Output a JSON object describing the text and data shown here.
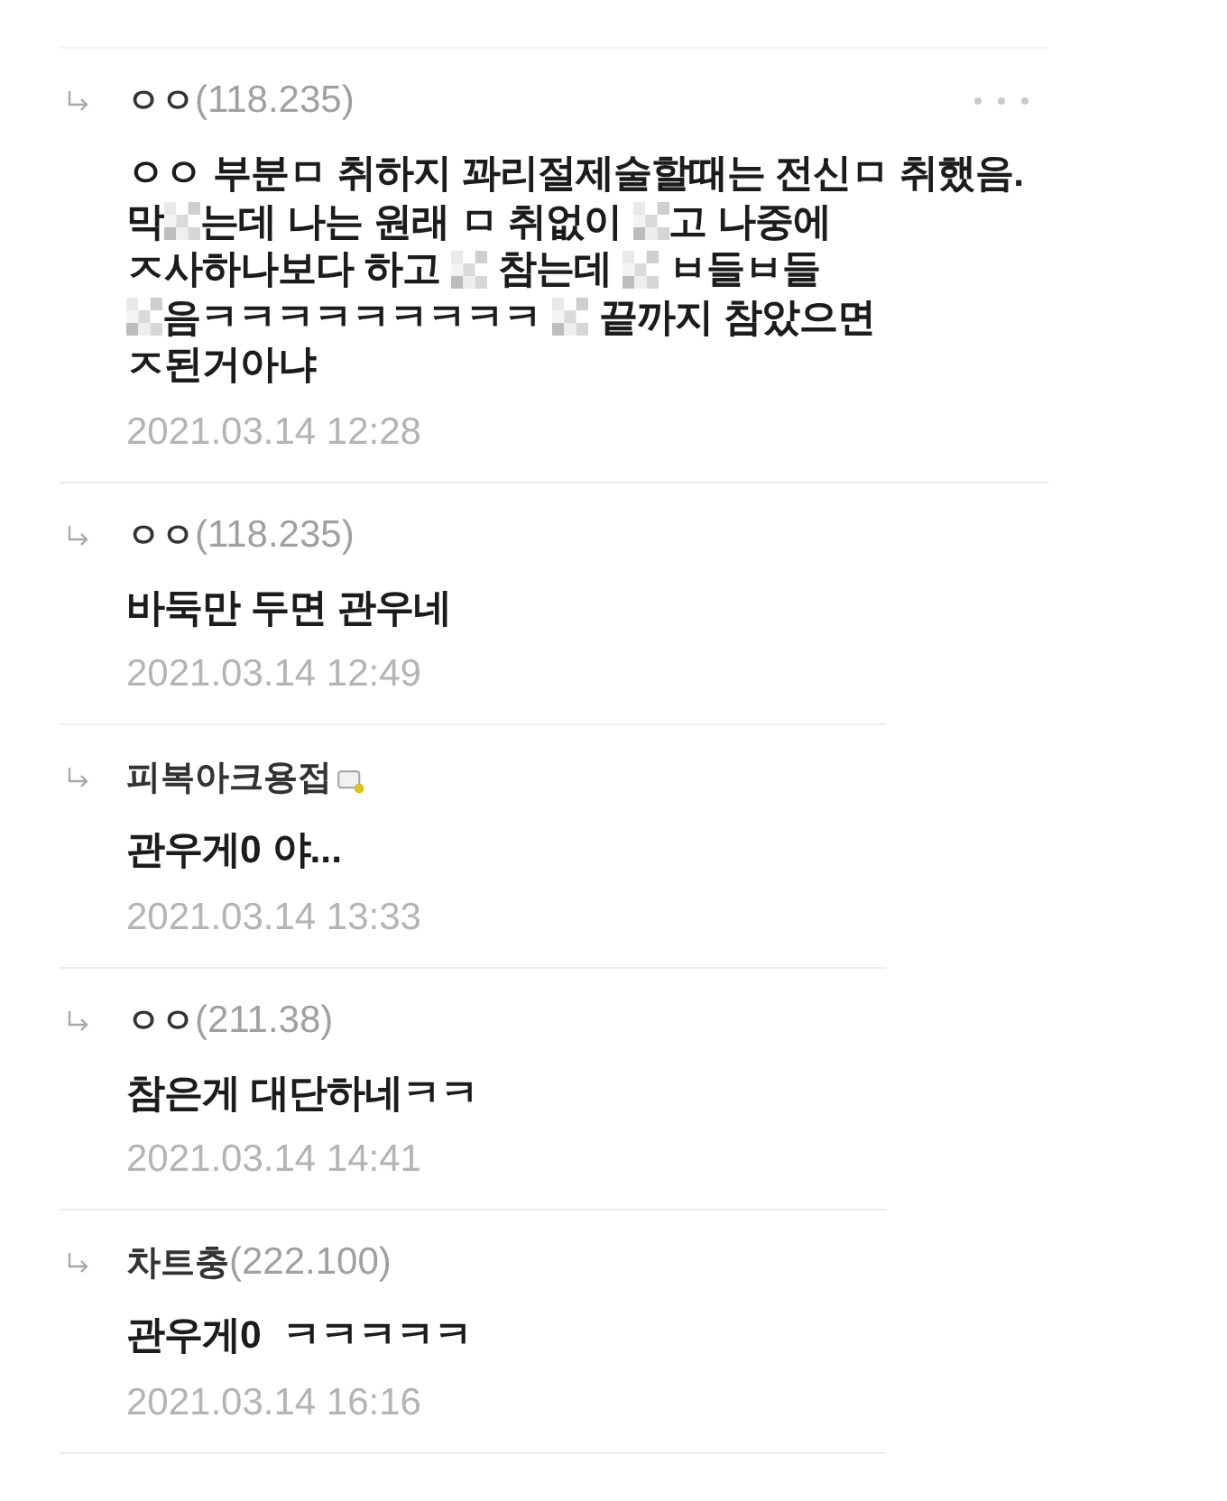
{
  "comments": [
    {
      "nickname": "ㅇㅇ",
      "ip": "(118.235)",
      "badge": false,
      "menu": true,
      "body": [
        [
          {
            "kind": "text",
            "text": "ㅇㅇ 부분ㅁ 취하지 꽈리절제술할때는 전신ㅁ 취했음."
          }
        ],
        [
          {
            "kind": "text",
            "text": "막"
          },
          {
            "kind": "mosaic"
          },
          {
            "kind": "text",
            "text": "는데 나는 원래 ㅁ 취없이 "
          },
          {
            "kind": "mosaic"
          },
          {
            "kind": "text",
            "text": "고 나중에"
          }
        ],
        [
          {
            "kind": "text",
            "text": "ㅈ사하나보다 하고 "
          },
          {
            "kind": "mosaic"
          },
          {
            "kind": "text",
            "text": " 참는데 "
          },
          {
            "kind": "mosaic"
          },
          {
            "kind": "text",
            "text": " ㅂ들ㅂ들"
          }
        ],
        [
          {
            "kind": "mosaic"
          },
          {
            "kind": "text",
            "text": "음ㅋㅋㅋㅋㅋㅋㅋㅋㅋ "
          },
          {
            "kind": "mosaic"
          },
          {
            "kind": "text",
            "text": " 끝까지 참았으면"
          }
        ],
        [
          {
            "kind": "text",
            "text": "ㅈ된거아냐"
          }
        ]
      ],
      "date": "2021.03.14 12:28"
    },
    {
      "nickname": "ㅇㅇ",
      "ip": "(118.235)",
      "badge": false,
      "menu": false,
      "body": [
        [
          {
            "kind": "text",
            "text": "바둑만 두면 관우네"
          }
        ]
      ],
      "date": "2021.03.14 12:49"
    },
    {
      "nickname": "피복아크용접",
      "badge": true,
      "menu": false,
      "body": [
        [
          {
            "kind": "text",
            "text": "관우게0 야..."
          }
        ]
      ],
      "date": "2021.03.14 13:33"
    },
    {
      "nickname": "ㅇㅇ",
      "ip": "(211.38)",
      "badge": false,
      "menu": false,
      "body": [
        [
          {
            "kind": "text",
            "text": "참은게 대단하네ㅋㅋ"
          }
        ]
      ],
      "date": "2021.03.14 14:41"
    },
    {
      "nickname": "차트충",
      "ip": "(222.100)",
      "badge": false,
      "menu": false,
      "body": [
        [
          {
            "kind": "text",
            "text": "관우게0  ㅋㅋㅋㅋㅋ"
          }
        ]
      ],
      "date": "2021.03.14 16:16"
    }
  ]
}
